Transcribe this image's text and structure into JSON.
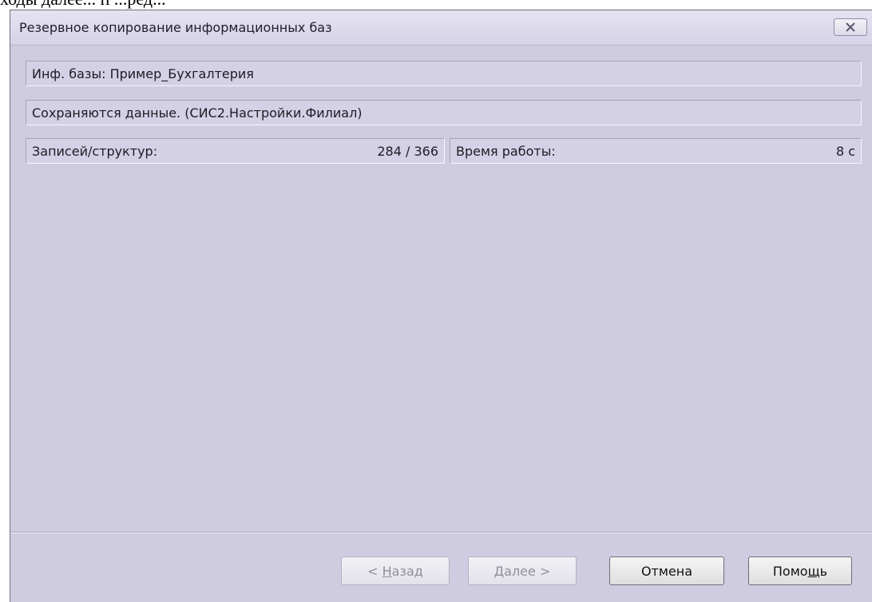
{
  "background_text": "ходы далее... п ...ред...",
  "window": {
    "title": "Резервное копирование информационных баз"
  },
  "fields": {
    "info_base_label": "Инф. базы:",
    "info_base_value": "Пример_Бухгалтерия",
    "status": "Сохраняются данные. (СИС2.Настройки.Филиал)",
    "records_label": "Записей/структур:",
    "records_value": "284 / 366",
    "time_label": "Время работы:",
    "time_value": "8 с"
  },
  "buttons": {
    "back_prefix": "< ",
    "back_mnemonic": "Н",
    "back_rest": "азад",
    "next_mnemonic": "Д",
    "next_rest": "алее >",
    "cancel": "Отмена",
    "help_start": "Помо",
    "help_mnemonic": "щ",
    "help_end": "ь"
  },
  "colors": {
    "window_bg": "#cfcbe0",
    "field_bg": "#d4d0e5",
    "disabled_text": "#8f8f99"
  },
  "icons": {
    "close": "close-icon"
  }
}
